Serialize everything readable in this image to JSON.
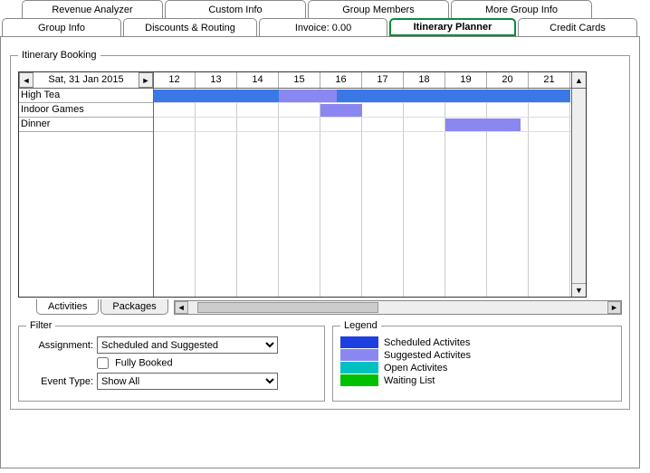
{
  "tabs": {
    "top": [
      "Revenue Analyzer",
      "Custom Info",
      "Group Members",
      "More Group Info"
    ],
    "bottom": [
      "Group Info",
      "Discounts & Routing",
      "Invoice: 0.00",
      "Itinerary Planner",
      "Credit Cards"
    ]
  },
  "active_tab": "Itinerary Planner",
  "panel_title": "Itinerary Booking",
  "date": "Sat, 31 Jan 2015",
  "hours": [
    "12",
    "13",
    "14",
    "15",
    "16",
    "17",
    "18",
    "19",
    "20",
    "21"
  ],
  "activities": [
    {
      "name": "High Tea",
      "bars": [
        {
          "start_hour": 12,
          "end_hour": 22,
          "type": "scheduled"
        },
        {
          "start_hour": 15,
          "end_hour": 16.4,
          "type": "suggested",
          "overlay": true
        }
      ]
    },
    {
      "name": "Indoor Games",
      "bars": [
        {
          "start_hour": 16,
          "end_hour": 17,
          "type": "suggested"
        }
      ]
    },
    {
      "name": "Dinner",
      "bars": [
        {
          "start_hour": 19,
          "end_hour": 20.8,
          "type": "suggested"
        }
      ]
    }
  ],
  "sub_tabs": [
    "Activities",
    "Packages"
  ],
  "active_sub_tab": "Activities",
  "filter": {
    "title": "Filter",
    "assignment_label": "Assignment:",
    "assignment_value": "Scheduled and Suggested",
    "fully_booked_label": "Fully Booked",
    "fully_booked_checked": false,
    "event_type_label": "Event Type:",
    "event_type_value": "Show All"
  },
  "legend": {
    "title": "Legend",
    "items": [
      {
        "color": "c-blue",
        "label": "Scheduled Activites"
      },
      {
        "color": "c-purple",
        "label": "Suggested Activites"
      },
      {
        "color": "c-teal",
        "label": "Open Activites"
      },
      {
        "color": "c-green",
        "label": "Waiting List"
      }
    ]
  },
  "chart_data": {
    "type": "gantt",
    "title": "Itinerary Booking",
    "x_unit": "hour_of_day",
    "x_range": [
      12,
      22
    ],
    "categories": [
      "High Tea",
      "Indoor Games",
      "Dinner"
    ],
    "series": [
      {
        "name": "Scheduled Activites",
        "bars": [
          {
            "row": "High Tea",
            "start": 12,
            "end": 22
          }
        ]
      },
      {
        "name": "Suggested Activites",
        "bars": [
          {
            "row": "High Tea",
            "start": 15,
            "end": 16.4
          },
          {
            "row": "Indoor Games",
            "start": 16,
            "end": 17
          },
          {
            "row": "Dinner",
            "start": 19,
            "end": 20.8
          }
        ]
      }
    ]
  }
}
